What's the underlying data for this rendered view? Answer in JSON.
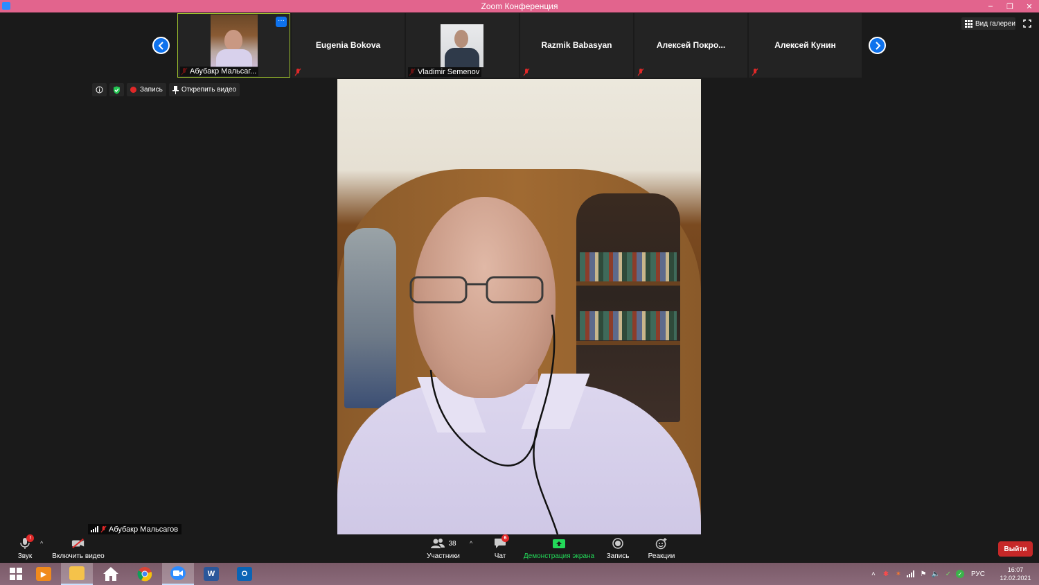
{
  "window": {
    "title": "Zoom Конференция",
    "controls": {
      "minimize": "–",
      "restore": "❐",
      "close": "✕"
    }
  },
  "gallery": {
    "tiles": [
      {
        "name": "Абубакр Мальсаг...",
        "has_video": true,
        "muted": true,
        "active_speaker": true
      },
      {
        "name": "Eugenia Bokova",
        "has_video": false,
        "muted": true
      },
      {
        "name": "Vladimir Semenov",
        "has_video": true,
        "muted": true
      },
      {
        "name": "Razmik Babasyan",
        "has_video": false,
        "muted": true
      },
      {
        "name": "Алексей  Покро...",
        "has_video": false,
        "muted": true
      },
      {
        "name": "Алексей Кунин",
        "has_video": false,
        "muted": true
      }
    ],
    "more_label": "···",
    "view_button": "Вид галереи"
  },
  "info_bar": {
    "recording_label": "Запись",
    "unpin_label": "Открепить видео"
  },
  "speaker": {
    "name": "Абубакр Мальсагов"
  },
  "toolbar": {
    "audio_label": "Звук",
    "video_label": "Включить видео",
    "participants_label": "Участники",
    "participants_count": "38",
    "chat_label": "Чат",
    "chat_badge": "6",
    "share_label": "Демонстрация экрана",
    "record_label": "Запись",
    "reactions_label": "Реакции",
    "leave_label": "Выйти",
    "share_color": "#23d959"
  },
  "taskbar": {
    "apps": [
      "windows-start",
      "media-player",
      "file-explorer",
      "home",
      "chrome",
      "zoom",
      "word",
      "outlook"
    ],
    "language": "РУС",
    "time": "16:07",
    "date": "12.02.2021"
  }
}
